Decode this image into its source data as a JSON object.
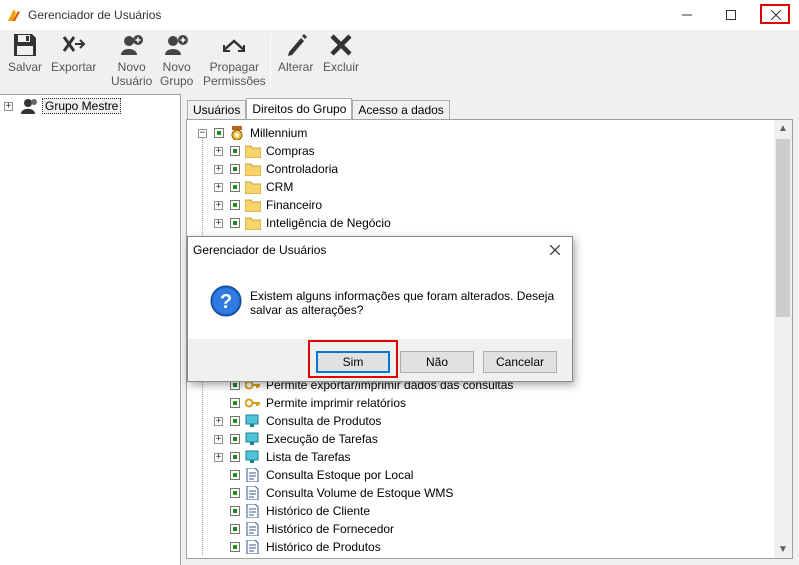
{
  "window": {
    "title": "Gerenciador de Usuários"
  },
  "toolbar": {
    "buttons": [
      {
        "label": "Salvar",
        "icon": "floppy-disk-icon"
      },
      {
        "label": "Exportar",
        "icon": "export-icon"
      },
      {
        "label": "Novo\nUsuário",
        "icon": "add-user-icon"
      },
      {
        "label": "Novo\nGrupo",
        "icon": "add-group-icon"
      },
      {
        "label": "Propagar\nPermissões",
        "icon": "propagate-icon"
      },
      {
        "label": "Alterar",
        "icon": "pencil-icon"
      },
      {
        "label": "Excluir",
        "icon": "delete-x-icon"
      }
    ]
  },
  "left_tree": {
    "root_label": "Grupo Mestre"
  },
  "tabs": [
    {
      "label": "Usuários",
      "active": false
    },
    {
      "label": "Direitos do Grupo",
      "active": true
    },
    {
      "label": "Acesso a dados",
      "active": false
    }
  ],
  "rights_tree": {
    "root": "Millennium",
    "items": [
      {
        "label": "Compras",
        "icon": "folder-icon"
      },
      {
        "label": "Controladoria",
        "icon": "folder-icon"
      },
      {
        "label": "CRM",
        "icon": "folder-icon"
      },
      {
        "label": "Financeiro",
        "icon": "folder-icon"
      },
      {
        "label": "Inteligência de Negócio",
        "icon": "folder-icon"
      },
      {
        "label": "Permite exportar/imprimir dados das consultas",
        "icon": "key-icon"
      },
      {
        "label": "Permite imprimir relatórios",
        "icon": "key-icon"
      },
      {
        "label": "Consulta de Produtos",
        "icon": "screen-icon"
      },
      {
        "label": "Execução de Tarefas",
        "icon": "screen-icon"
      },
      {
        "label": "Lista de Tarefas",
        "icon": "screen-icon"
      },
      {
        "label": "Consulta Estoque por Local",
        "icon": "document-icon"
      },
      {
        "label": "Consulta Volume de Estoque WMS",
        "icon": "document-icon"
      },
      {
        "label": "Histórico de Cliente",
        "icon": "document-icon"
      },
      {
        "label": "Histórico de Fornecedor",
        "icon": "document-icon"
      },
      {
        "label": "Histórico de Produtos",
        "icon": "document-icon"
      }
    ]
  },
  "dialog": {
    "title": "Gerenciador de Usuários",
    "message": "Existem alguns informações que foram alterados. Deseja salvar as alterações?",
    "buttons": {
      "yes": "Sim",
      "no": "Não",
      "cancel": "Cancelar"
    }
  },
  "colors": {
    "highlight": "#e00000",
    "accent": "#0078d7",
    "check": "#1f8a1f",
    "folder": "#f7d36b"
  }
}
